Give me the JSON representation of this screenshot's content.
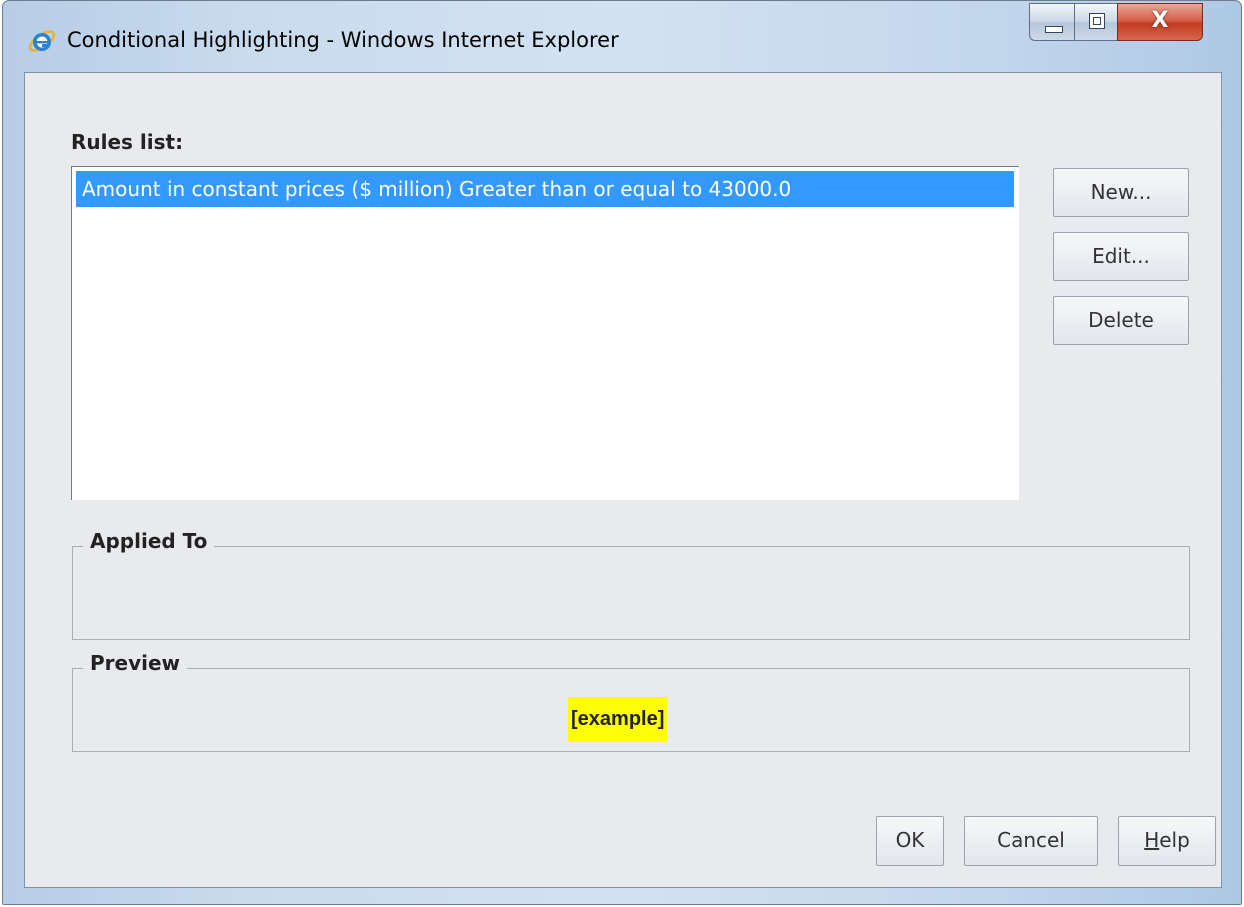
{
  "window": {
    "title": "Conditional Highlighting - Windows Internet Explorer",
    "app_icon": "internet-explorer-icon",
    "controls": {
      "minimize_icon": "minimize-icon",
      "maximize_icon": "maximize-icon",
      "close_glyph": "X"
    }
  },
  "rules": {
    "label": "Rules list:",
    "items": [
      {
        "text": "Amount in constant prices ($ million) Greater than or equal to 43000.0",
        "selected": true
      }
    ]
  },
  "buttons": {
    "new": "New...",
    "edit": "Edit...",
    "delete": "Delete",
    "ok": "OK",
    "cancel": "Cancel",
    "help_mnemonic": "H",
    "help_rest": "elp"
  },
  "applied_to": {
    "legend": "Applied To"
  },
  "preview": {
    "legend": "Preview",
    "sample_text": "[example]",
    "highlight_color": "#ffff00"
  },
  "colors": {
    "selection": "#3399ff",
    "dialog_bg": "#e8eaed"
  }
}
